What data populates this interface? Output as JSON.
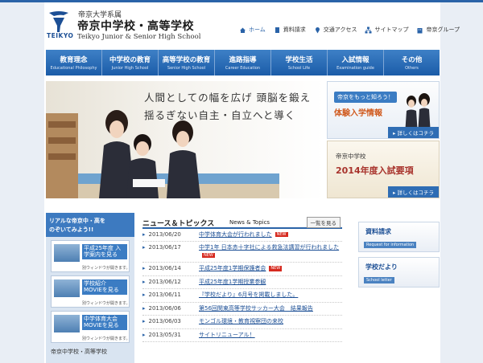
{
  "header": {
    "brand_sub": "帝京大学系属",
    "brand_main": "帝京中学校・高等学校",
    "brand_en": "Teikyo Junior & Senior High School",
    "brand_mark_text": "TEIKYO"
  },
  "utility_nav": [
    {
      "label": "ホーム",
      "icon": "home-icon"
    },
    {
      "label": "資料請求",
      "icon": "document-icon"
    },
    {
      "label": "交通アクセス",
      "icon": "pin-icon"
    },
    {
      "label": "サイトマップ",
      "icon": "sitemap-icon"
    },
    {
      "label": "帝京グループ",
      "icon": "building-icon"
    }
  ],
  "main_nav": [
    {
      "jp": "教育理念",
      "en": "Educational Philosophy"
    },
    {
      "jp": "中学校の教育",
      "en": "Junior High School"
    },
    {
      "jp": "高等学校の教育",
      "en": "Senior High School"
    },
    {
      "jp": "進路指導",
      "en": "Career Education"
    },
    {
      "jp": "学校生活",
      "en": "School Life"
    },
    {
      "jp": "入試情報",
      "en": "Examination guide"
    },
    {
      "jp": "その他",
      "en": "Others"
    }
  ],
  "hero": {
    "line1": "人間としての幅を広げ 頭脳を鍛え",
    "line2": "揺るぎない自主・自立へと導く"
  },
  "banners": [
    {
      "small": "帝京をもっと知ろう！",
      "main": "体験入学情報",
      "more": "詳しくはコチラ"
    },
    {
      "small": "帝京中学校",
      "main": "2014年度入試要項",
      "more": "詳しくはコチラ"
    }
  ],
  "left": {
    "head1": "リアルな帝京中・高を",
    "head2": "のぞいてみよう!!",
    "movies": [
      {
        "title": "平成25年度 入学案内を見る",
        "note": "別ウィンドウが開きます。"
      },
      {
        "title": "学校紹介 MOVIEを見る",
        "note": "別ウィンドウが開きます。"
      },
      {
        "title": "中学体育大会 MOVIEを見る",
        "note": "別ウィンドウが開きます。"
      }
    ],
    "bottom_logo": "帝京中学校・高等学校"
  },
  "news": {
    "title": "ニュース＆トピックス",
    "title_en": "News & Topics",
    "list_button": "一覧を見る",
    "new_label": "NEW",
    "items": [
      {
        "date": "2013/06/20",
        "text": "中学体育大会が行われました",
        "new": true
      },
      {
        "date": "2013/06/17",
        "text": "中学1年 日本赤十字社による救急法講習が行われました",
        "new": true
      },
      {
        "date": "2013/06/14",
        "text": "平成25年度1学期保護者会",
        "new": true
      },
      {
        "date": "2013/06/12",
        "text": "平成25年度1学期授業参観",
        "new": false
      },
      {
        "date": "2013/06/11",
        "text": "『学校だより』6月号を掲載しました。",
        "new": false
      },
      {
        "date": "2013/06/06",
        "text": "第56回関東高等学校サッカー大会　結果報告",
        "new": false
      },
      {
        "date": "2013/06/03",
        "text": "モンゴル環境・教育視察団の来校",
        "new": false
      },
      {
        "date": "2013/05/31",
        "text": "サイトリニューアル！",
        "new": false
      }
    ]
  },
  "right": [
    {
      "title": "資料請求",
      "sub": "Request for information"
    },
    {
      "title": "学校だより",
      "sub": "School letter"
    }
  ],
  "colors": {
    "accent": "#2a63a8",
    "nav": "#1c5fae",
    "new_badge": "#d62a1f",
    "banner_orange": "#d05a1e",
    "banner_red": "#a8332c"
  }
}
